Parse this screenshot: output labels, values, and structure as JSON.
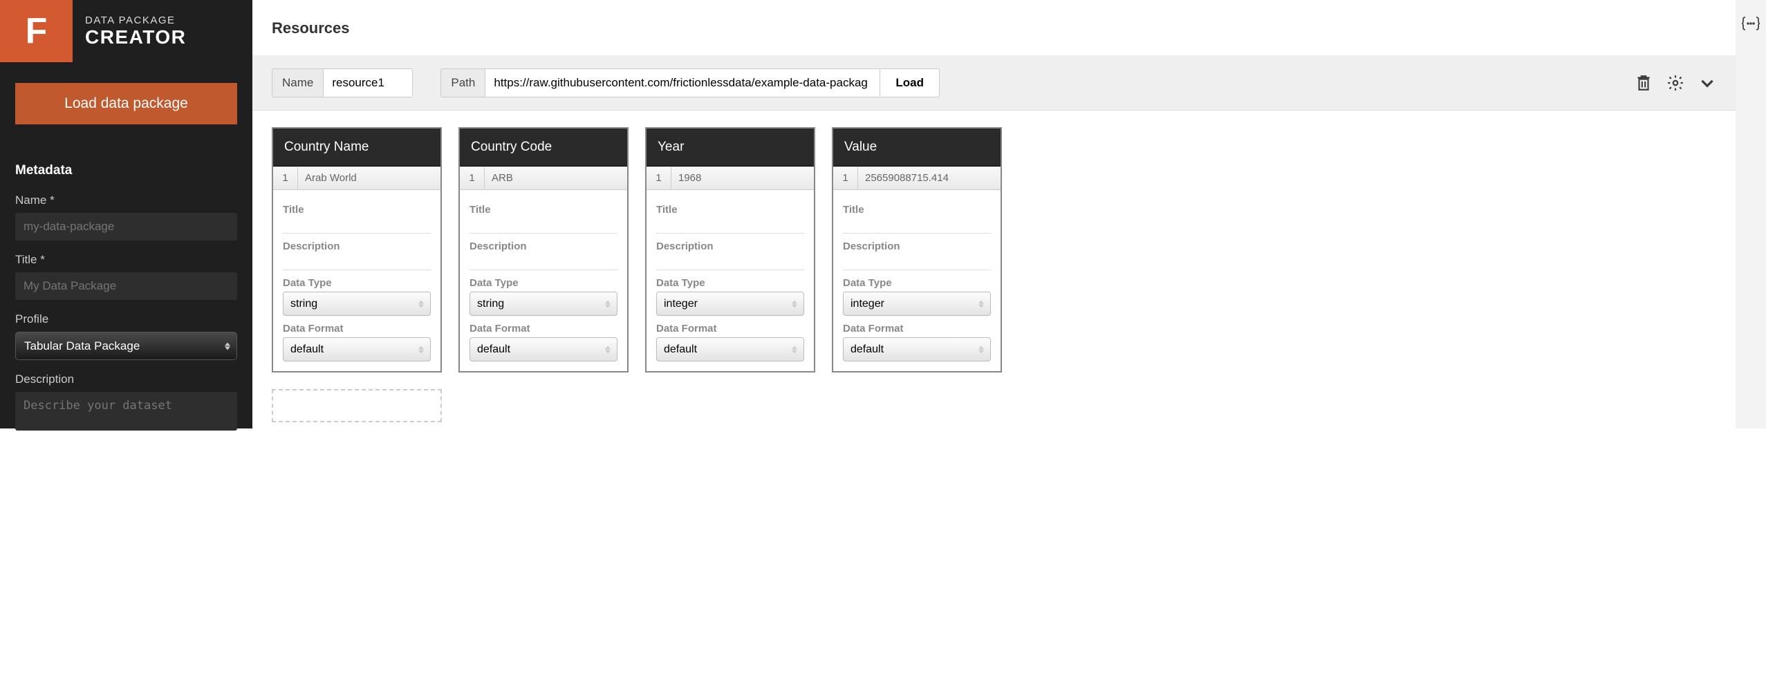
{
  "sidebar": {
    "logo_line1": "DATA PACKAGE",
    "logo_line2": "CREATOR",
    "load_button": "Load data package",
    "metadata_heading": "Metadata",
    "fields": {
      "name_label": "Name *",
      "name_placeholder": "my-data-package",
      "title_label": "Title *",
      "title_placeholder": "My Data Package",
      "profile_label": "Profile",
      "profile_value": "Tabular Data Package",
      "description_label": "Description",
      "description_placeholder": "Describe your dataset"
    }
  },
  "main": {
    "heading": "Resources",
    "name_label": "Name",
    "name_value": "resource1",
    "path_label": "Path",
    "path_value": "https://raw.githubusercontent.com/frictionlessdata/example-data-packag",
    "load_label": "Load"
  },
  "field_labels": {
    "title": "Title",
    "description": "Description",
    "data_type": "Data Type",
    "data_format": "Data Format"
  },
  "columns": [
    {
      "header": "Country Name",
      "sample_idx": "1",
      "sample_val": "Arab World",
      "data_type": "string",
      "data_format": "default"
    },
    {
      "header": "Country Code",
      "sample_idx": "1",
      "sample_val": "ARB",
      "data_type": "string",
      "data_format": "default"
    },
    {
      "header": "Year",
      "sample_idx": "1",
      "sample_val": "1968",
      "data_type": "integer",
      "data_format": "default"
    },
    {
      "header": "Value",
      "sample_idx": "1",
      "sample_val": "25659088715.414",
      "data_type": "integer",
      "data_format": "default"
    }
  ]
}
